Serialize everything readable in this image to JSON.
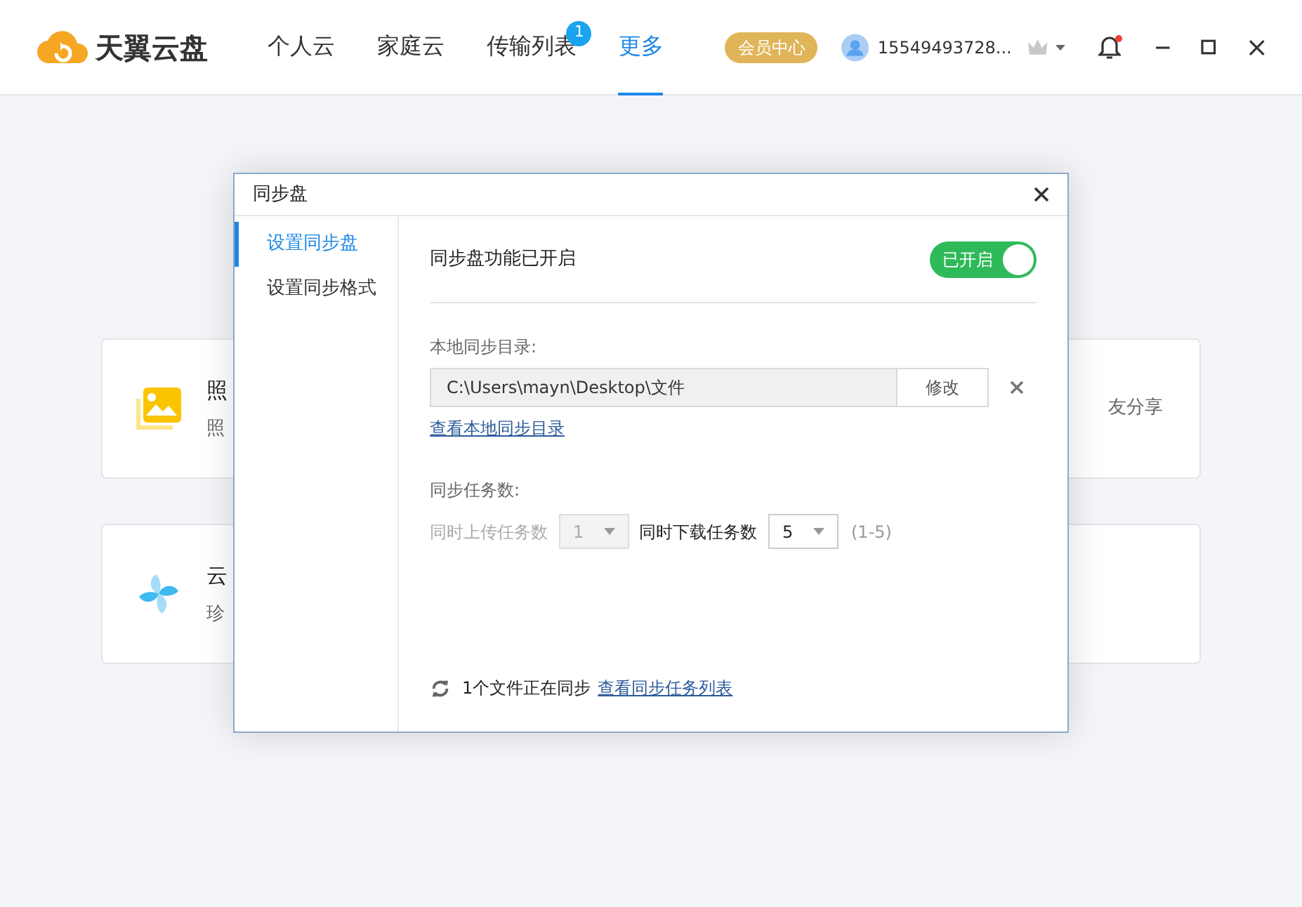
{
  "header": {
    "logo_text": "天翼云盘",
    "nav": [
      {
        "label": "个人云",
        "selected": false
      },
      {
        "label": "家庭云",
        "selected": false
      },
      {
        "label": "传输列表",
        "selected": false,
        "badge": "1"
      },
      {
        "label": "更多",
        "selected": true
      }
    ],
    "vip_button": "会员中心",
    "user": "15549493728...",
    "notification_unread": true
  },
  "cards": [
    {
      "kind": "photo",
      "title": "照",
      "subtitle": "照"
    },
    {
      "kind": "blank",
      "subtitle": "友分享"
    },
    {
      "kind": "pinwheel",
      "title": "云",
      "subtitle": "珍"
    },
    {
      "kind": "blank"
    }
  ],
  "dialog": {
    "title": "同步盘",
    "sidebar": [
      {
        "label": "设置同步盘",
        "selected": true
      },
      {
        "label": "设置同步格式",
        "selected": false
      }
    ],
    "sync_label": "同步盘功能已开启",
    "switch": {
      "on": true,
      "label": "已开启"
    },
    "dir_label": "本地同步目录:",
    "dir_value": "C:\\Users\\mayn\\Desktop\\文件",
    "modify_button": "修改",
    "dir_link": "查看本地同步目录",
    "tasks_label": "同步任务数:",
    "upload_label": "同时上传任务数",
    "upload_value": "1",
    "upload_disabled": true,
    "download_label": "同时下载任务数",
    "download_value": "5",
    "download_disabled": false,
    "range": "(1-5)",
    "status": "1个文件正在同步",
    "status_link": "查看同步任务列表"
  }
}
